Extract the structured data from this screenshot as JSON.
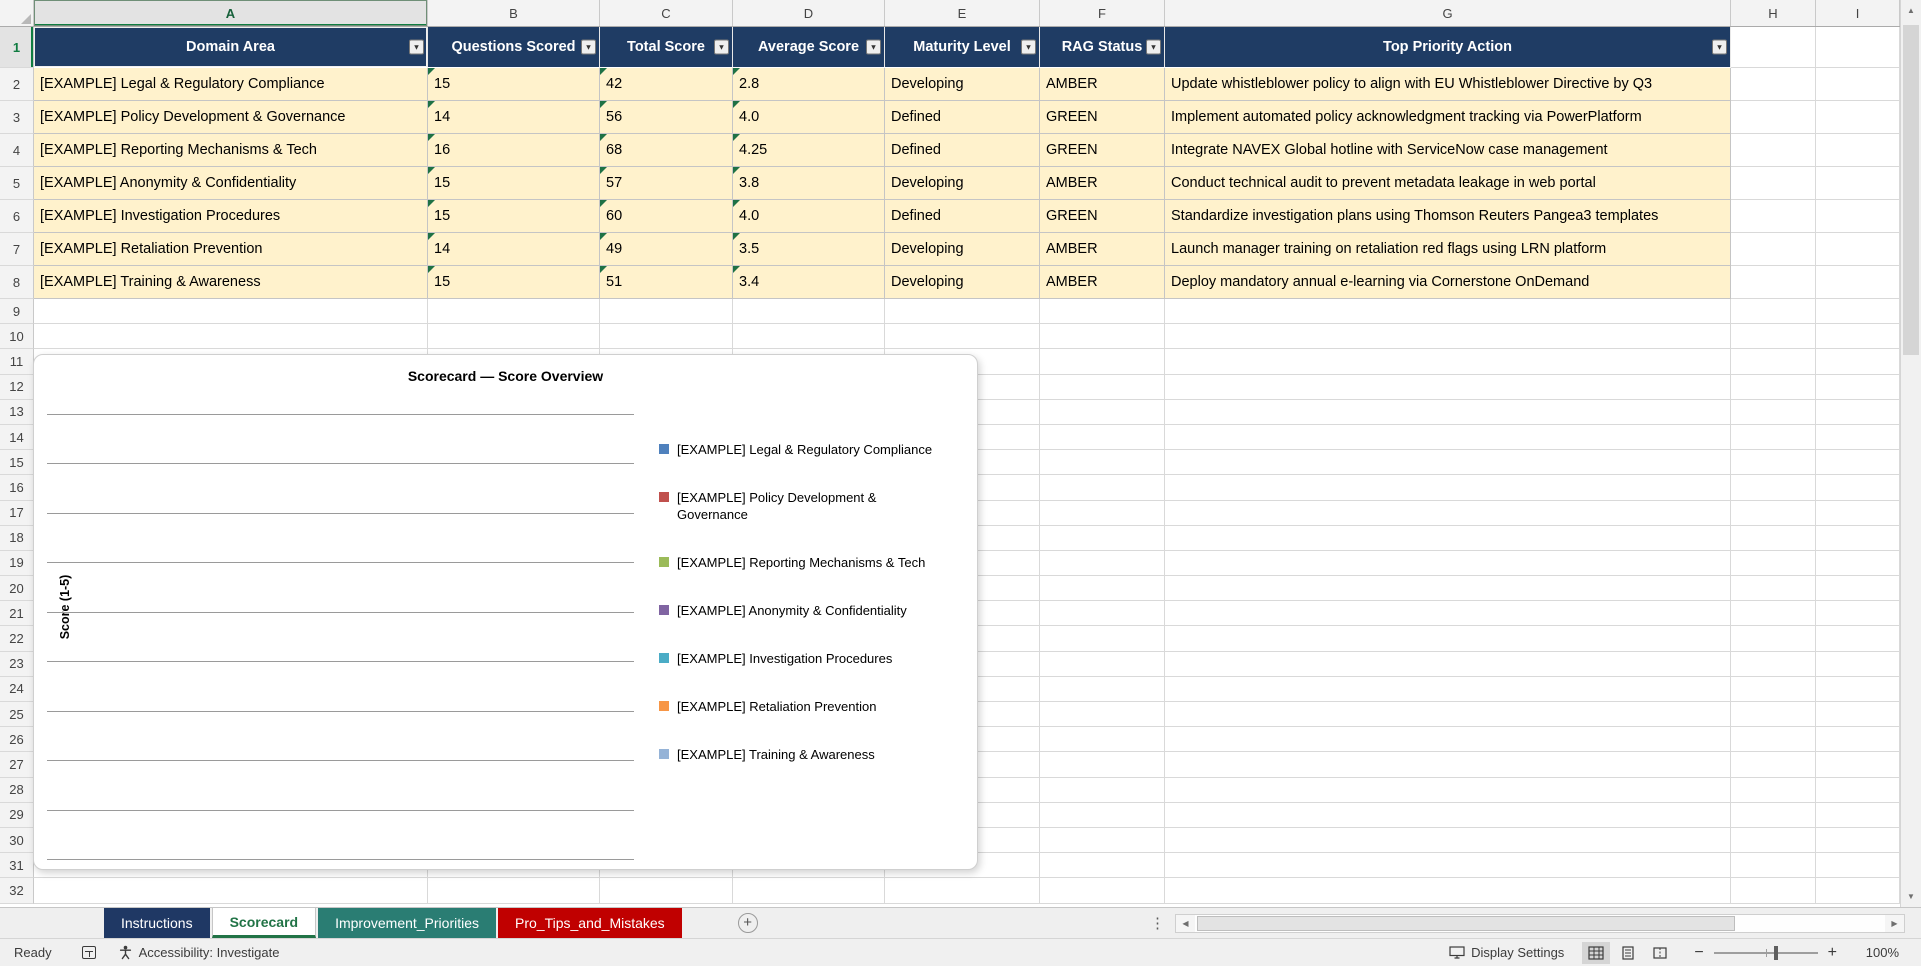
{
  "grid": {
    "columns": [
      "A",
      "B",
      "C",
      "D",
      "E",
      "F",
      "G",
      "H",
      "I"
    ],
    "row_numbers": [
      "1",
      "2",
      "3",
      "4",
      "5",
      "6",
      "7",
      "8",
      "9",
      "10",
      "11",
      "12",
      "13",
      "14",
      "15",
      "16",
      "17",
      "18",
      "19",
      "20",
      "21",
      "22",
      "23",
      "24",
      "25",
      "26",
      "27",
      "28",
      "29",
      "30",
      "31",
      "32"
    ],
    "selected_column": "A",
    "selected_row": "1"
  },
  "table": {
    "headers": {
      "domain": "Domain Area",
      "questions": "Questions Scored",
      "total": "Total Score",
      "average": "Average Score",
      "maturity": "Maturity Level",
      "rag": "RAG Status",
      "action": "Top Priority Action"
    },
    "rows": [
      {
        "domain": "[EXAMPLE] Legal & Regulatory Compliance",
        "questions": "15",
        "total": "42",
        "average": "2.8",
        "maturity": "Developing",
        "rag": "AMBER",
        "action": "Update whistleblower policy to align with EU Whistleblower Directive by Q3"
      },
      {
        "domain": "[EXAMPLE] Policy Development & Governance",
        "questions": "14",
        "total": "56",
        "average": "4.0",
        "maturity": "Defined",
        "rag": "GREEN",
        "action": "Implement automated policy acknowledgment tracking via PowerPlatform"
      },
      {
        "domain": "[EXAMPLE] Reporting Mechanisms & Tech",
        "questions": "16",
        "total": "68",
        "average": "4.25",
        "maturity": "Defined",
        "rag": "GREEN",
        "action": "Integrate NAVEX Global hotline with ServiceNow case management"
      },
      {
        "domain": "[EXAMPLE] Anonymity & Confidentiality",
        "questions": "15",
        "total": "57",
        "average": "3.8",
        "maturity": "Developing",
        "rag": "AMBER",
        "action": "Conduct technical audit to prevent metadata leakage in web portal"
      },
      {
        "domain": "[EXAMPLE] Investigation Procedures",
        "questions": "15",
        "total": "60",
        "average": "4.0",
        "maturity": "Defined",
        "rag": "GREEN",
        "action": "Standardize investigation plans using Thomson Reuters Pangea3 templates"
      },
      {
        "domain": "[EXAMPLE] Retaliation Prevention",
        "questions": "14",
        "total": "49",
        "average": "3.5",
        "maturity": "Developing",
        "rag": "AMBER",
        "action": "Launch manager training on retaliation red flags using LRN platform"
      },
      {
        "domain": "[EXAMPLE] Training & Awareness",
        "questions": "15",
        "total": "51",
        "average": "3.4",
        "maturity": "Developing",
        "rag": "AMBER",
        "action": "Deploy mandatory annual e-learning via Cornerstone OnDemand"
      }
    ]
  },
  "chart": {
    "title": "Scorecard — Score Overview",
    "y_axis_label": "Score (1-5)",
    "gridline_count": 10,
    "legend": [
      {
        "label": "[EXAMPLE] Legal & Regulatory Compliance",
        "color": "#4F81BD"
      },
      {
        "label": "[EXAMPLE] Policy Development & Governance",
        "color": "#C0504D"
      },
      {
        "label": "[EXAMPLE] Reporting Mechanisms & Tech",
        "color": "#9BBB59"
      },
      {
        "label": "[EXAMPLE] Anonymity & Confidentiality",
        "color": "#8064A2"
      },
      {
        "label": "[EXAMPLE] Investigation Procedures",
        "color": "#4BACC6"
      },
      {
        "label": "[EXAMPLE] Retaliation Prevention",
        "color": "#F79646"
      },
      {
        "label": "[EXAMPLE] Training & Awareness",
        "color": "#95B3D7"
      }
    ]
  },
  "sheet_tabs": [
    {
      "label": "Instructions",
      "color": "#1F3864",
      "active": false
    },
    {
      "label": "Scorecard",
      "color": "#217346",
      "active": true
    },
    {
      "label": "Improvement_Priorities",
      "color": "#2A7D73",
      "active": false
    },
    {
      "label": "Pro_Tips_and_Mistakes",
      "color": "#C00000",
      "active": false
    }
  ],
  "status_bar": {
    "ready": "Ready",
    "accessibility": "Accessibility: Investigate",
    "display_settings": "Display Settings",
    "zoom_level": "100%"
  },
  "colors": {
    "table_header_bg": "#1F3C64",
    "table_row_bg": "#FFF2CC",
    "selection_green": "#107C41"
  },
  "icons": {
    "filter_arrow": "▾",
    "add_sheet": "+",
    "tab_options": "⋮",
    "scroll_left": "◀",
    "scroll_right": "▶",
    "scroll_up": "▲",
    "scroll_down": "▼",
    "zoom_out": "−",
    "zoom_in": "+"
  }
}
